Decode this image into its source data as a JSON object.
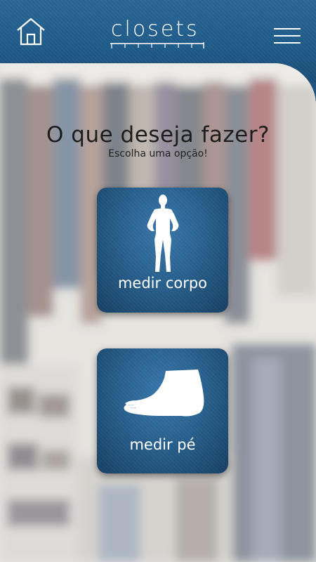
{
  "header": {
    "logo_text": "closets",
    "home_icon": "home-icon",
    "menu_icon": "hamburger-menu-icon"
  },
  "main": {
    "title": "O que deseja fazer?",
    "subtitle": "Escolha uma opção!",
    "options": [
      {
        "label": "medir corpo",
        "icon": "body-figure-icon"
      },
      {
        "label": "medir pé",
        "icon": "foot-icon"
      }
    ]
  },
  "colors": {
    "header_blue": "#1f5a88",
    "tile_blue": "#28618f",
    "text_dark": "#1d1d1d"
  }
}
